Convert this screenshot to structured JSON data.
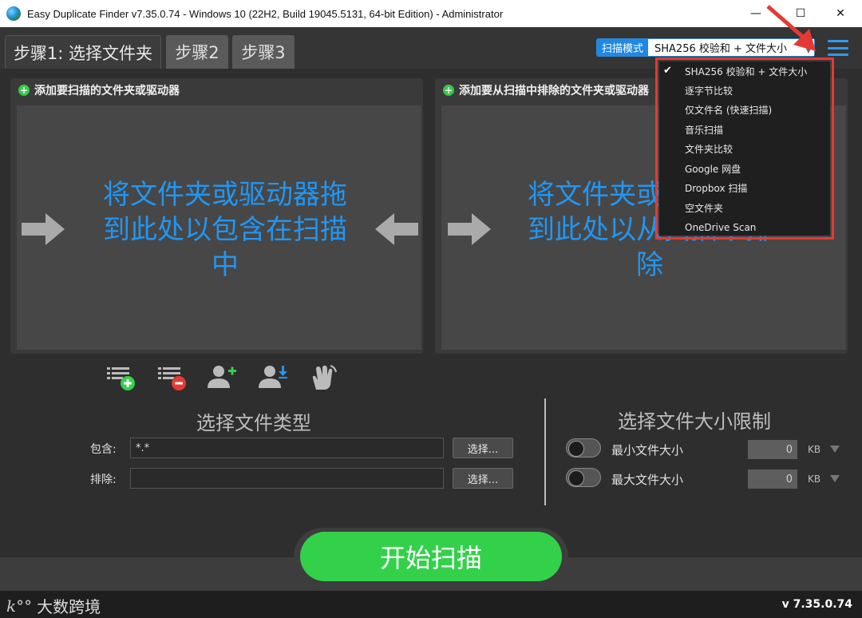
{
  "window": {
    "title": "Easy Duplicate Finder v7.35.0.74 - Windows 10 (22H2, Build 19045.5131, 64-bit Edition) - Administrator",
    "minimize": "—",
    "maximize": "☐",
    "close": "✕"
  },
  "tabs": [
    {
      "label": "步骤1: 选择文件夹"
    },
    {
      "label": "步骤2"
    },
    {
      "label": "步骤3"
    }
  ],
  "scan_mode": {
    "label": "扫描模式",
    "value": "SHA256 校验和 + 文件大小",
    "options": [
      "SHA256 校验和 + 文件大小",
      "逐字节比较",
      "仅文件名 (快速扫描)",
      "音乐扫描",
      "文件夹比较",
      "Google 网盘",
      "Dropbox 扫描",
      "空文件夹",
      "OneDrive Scan"
    ],
    "selected_index": 0
  },
  "include_panel": {
    "header": "添加要扫描的文件夹或驱动器",
    "drop_text": "将文件夹或驱动器拖到此处以包含在扫描中"
  },
  "exclude_panel": {
    "header": "添加要从扫描中排除的文件夹或驱动器",
    "drop_text": "将文件夹或驱动器拖到此处以从扫描中排除"
  },
  "toolbar_icons": [
    "add-list-icon",
    "remove-list-icon",
    "add-user-icon",
    "download-user-icon",
    "hand-pointer-icon"
  ],
  "file_types": {
    "title": "选择文件类型",
    "include_label": "包含:",
    "include_value": "*.*",
    "exclude_label": "排除:",
    "exclude_value": "",
    "select_button": "选择..."
  },
  "file_size": {
    "title": "选择文件大小限制",
    "min_label": "最小文件大小",
    "min_value": "0",
    "max_label": "最大文件大小",
    "max_value": "0",
    "unit": "KB"
  },
  "start_button": "开始扫描",
  "version": "v 7.35.0.74",
  "watermark": "大数跨境",
  "colors": {
    "accent_blue": "#2196f3",
    "start_green": "#33d14a",
    "highlight_red": "#e53935"
  }
}
